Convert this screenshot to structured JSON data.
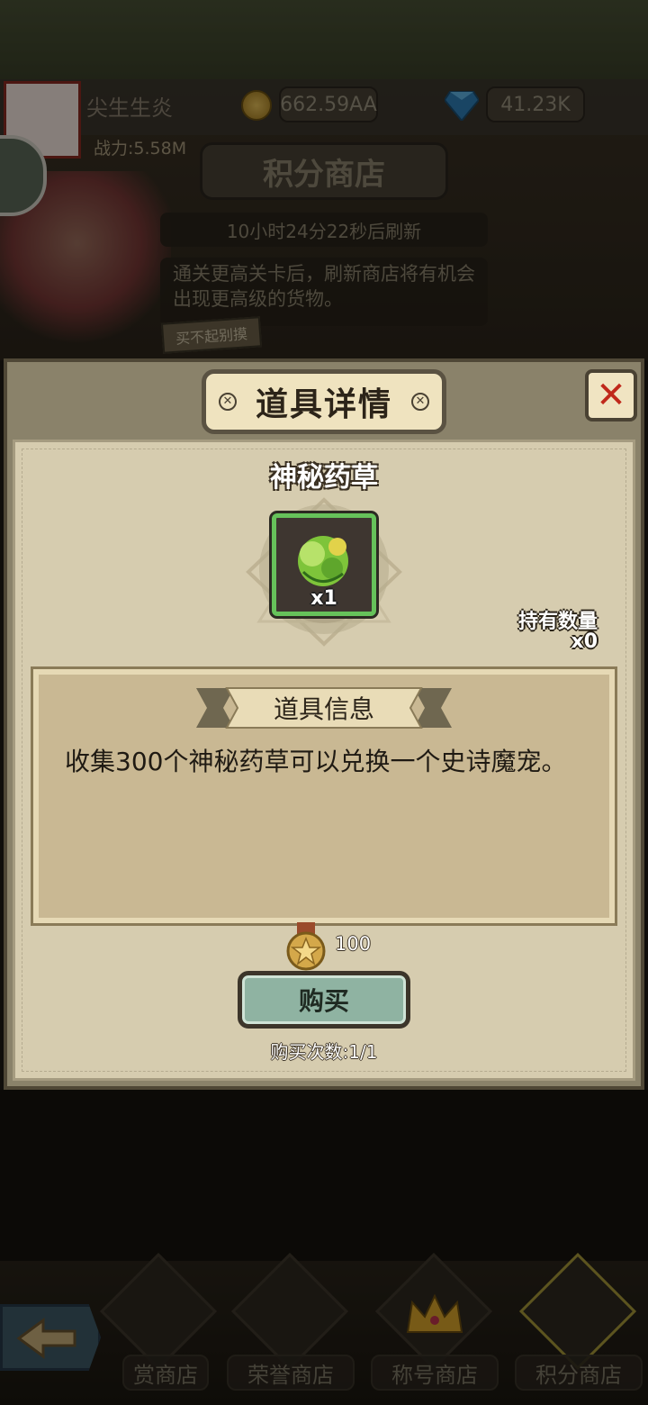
{
  "player": {
    "name": "尖生生炎",
    "power": "战力:5.58M"
  },
  "currencies": {
    "coins": "662.59AA",
    "diamonds": "41.23K"
  },
  "shop": {
    "title": "积分商店",
    "refresh": "10小时24分22秒后刷新",
    "hint": "通关更高关卡后，刷新商店将有机会出现更高级的货物。",
    "sign": "买不起别摸"
  },
  "modal": {
    "title": "道具详情",
    "item_name": "神秘药草",
    "item_qty": "x1",
    "owned_label": "持有数量",
    "owned_count": "x0",
    "info_header": "道具信息",
    "description": "收集300个神秘药草可以兑换一个史诗魔宠。",
    "price": "100",
    "buy_label": "购买",
    "buy_count": "购买次数:1/1",
    "close_symbol": "✕"
  },
  "nav": {
    "tabs": [
      {
        "label": "赏商店",
        "icon": "coin-icon"
      },
      {
        "label": "荣誉商店",
        "icon": "cross-medal-icon"
      },
      {
        "label": "称号商店",
        "icon": "crown-icon"
      },
      {
        "label": "积分商店",
        "icon": "star-medal-icon"
      }
    ]
  },
  "colors": {
    "accent_green": "#66c25a",
    "close_red": "#c0281b",
    "buy_button": "#8fb3a2"
  }
}
